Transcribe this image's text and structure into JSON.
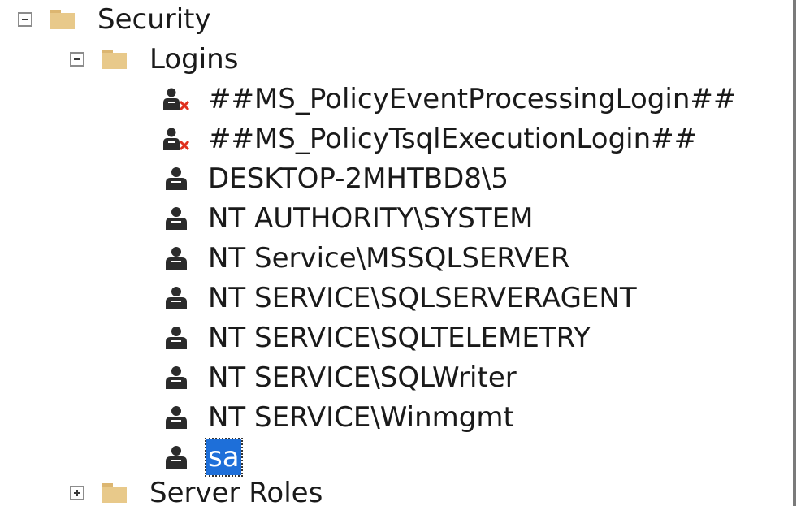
{
  "tree": {
    "security": {
      "label": "Security"
    },
    "logins": {
      "label": "Logins",
      "items": [
        {
          "label": "##MS_PolicyEventProcessingLogin##",
          "disabled": true
        },
        {
          "label": "##MS_PolicyTsqlExecutionLogin##",
          "disabled": true
        },
        {
          "label": "DESKTOP-2MHTBD8\\5"
        },
        {
          "label": "NT AUTHORITY\\SYSTEM"
        },
        {
          "label": "NT Service\\MSSQLSERVER"
        },
        {
          "label": "NT SERVICE\\SQLSERVERAGENT"
        },
        {
          "label": "NT SERVICE\\SQLTELEMETRY"
        },
        {
          "label": "NT SERVICE\\SQLWriter"
        },
        {
          "label": "NT SERVICE\\Winmgmt"
        },
        {
          "label": "sa",
          "selected": true
        }
      ]
    },
    "server_roles": {
      "label": "Server Roles"
    }
  },
  "icons": {
    "expanded": "collapse-box-icon",
    "collapsed": "expand-box-icon",
    "folder": "folder-icon",
    "login": "user-login-icon",
    "disabled_login": "disabled-login-icon"
  },
  "colors": {
    "folder": "#e8c98a",
    "selection": "#1e6fd9",
    "disabled_x": "#e0301e"
  }
}
